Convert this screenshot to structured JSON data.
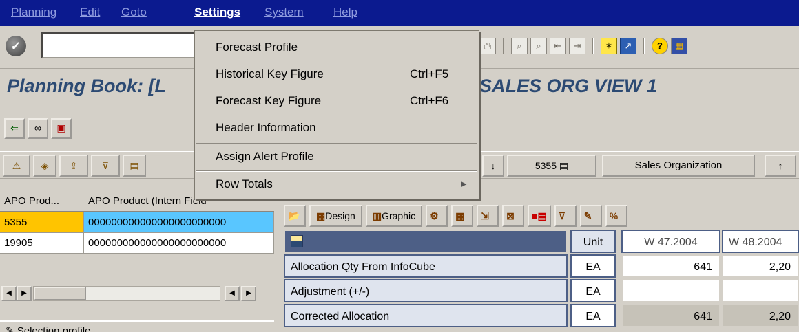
{
  "menubar": {
    "items": [
      "Planning",
      "Edit",
      "Goto",
      "Settings",
      "System",
      "Help"
    ]
  },
  "title": {
    "left": "Planning Book: [L",
    "right": "SALES ORG VIEW 1"
  },
  "settings_menu": {
    "items": [
      {
        "label": "Forecast Profile",
        "shortcut": ""
      },
      {
        "label": "Historical Key Figure",
        "shortcut": "Ctrl+F5"
      },
      {
        "label": "Forecast Key Figure",
        "shortcut": "Ctrl+F6"
      },
      {
        "label": "Header Information",
        "shortcut": ""
      },
      {
        "label": "Assign Alert Profile",
        "shortcut": ""
      },
      {
        "label": "Row Totals",
        "shortcut": ""
      }
    ]
  },
  "row2": {
    "product_number": "5355",
    "org_button": "Sales Organization"
  },
  "left_table": {
    "headers": [
      "APO Prod...",
      "APO Product (Intern Field"
    ],
    "rows": [
      [
        "5355",
        "000000000000000000000000"
      ],
      [
        "19905",
        "000000000000000000000000"
      ]
    ],
    "selection_profile": "Selection profile"
  },
  "grid_toolbar": {
    "design": "Design",
    "graphic": "Graphic"
  },
  "grid": {
    "unit_header": "Unit",
    "weeks": [
      "W 47.2004",
      "W 48.2004"
    ],
    "rows": [
      {
        "label": "Allocation Qty From InfoCube",
        "unit": "EA",
        "values": [
          "641",
          "2,20"
        ]
      },
      {
        "label": "Adjustment (+/-)",
        "unit": "EA",
        "values": [
          "",
          ""
        ]
      },
      {
        "label": "Corrected Allocation",
        "unit": "EA",
        "values": [
          "641",
          "2,20"
        ]
      }
    ]
  },
  "colors": {
    "menubar_bg": "#0b1a8f",
    "title_text": "#2c4a73",
    "selected_cell_orange": "#ffc400",
    "selected_cell_blue": "#59c6ff",
    "grid_header_bg": "#4d5f86"
  }
}
